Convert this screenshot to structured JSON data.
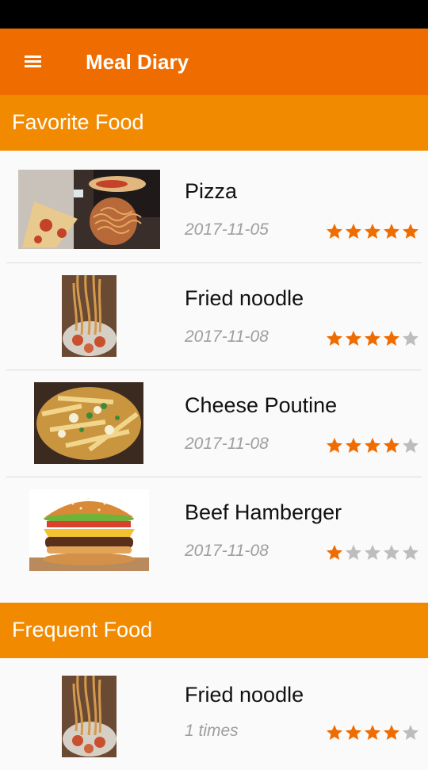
{
  "app_bar": {
    "title": "Meal Diary",
    "menu_icon": "hamburger-menu-icon",
    "color": "#ef6c00"
  },
  "colors": {
    "section_header": "#f28a00",
    "star_filled": "#ef6c00",
    "star_empty": "#bdbdbd"
  },
  "favorite": {
    "header": "Favorite Food",
    "items": [
      {
        "name": "Pizza",
        "date": "2017-11-05",
        "rating": 5,
        "image": "pizza-and-spaghetti-photo"
      },
      {
        "name": "Fried noodle",
        "date": "2017-11-08",
        "rating": 4,
        "image": "fried-noodle-photo"
      },
      {
        "name": "Cheese Poutine",
        "date": "2017-11-08",
        "rating": 4,
        "image": "cheese-poutine-photo"
      },
      {
        "name": "Beef Hamberger",
        "date": "2017-11-08",
        "rating": 1,
        "image": "hamburger-photo"
      }
    ]
  },
  "frequent": {
    "header": "Frequent Food",
    "items": [
      {
        "name": "Fried noodle",
        "count": "1 times",
        "rating": 4,
        "image": "fried-noodle-photo"
      }
    ]
  },
  "max_rating": 5
}
